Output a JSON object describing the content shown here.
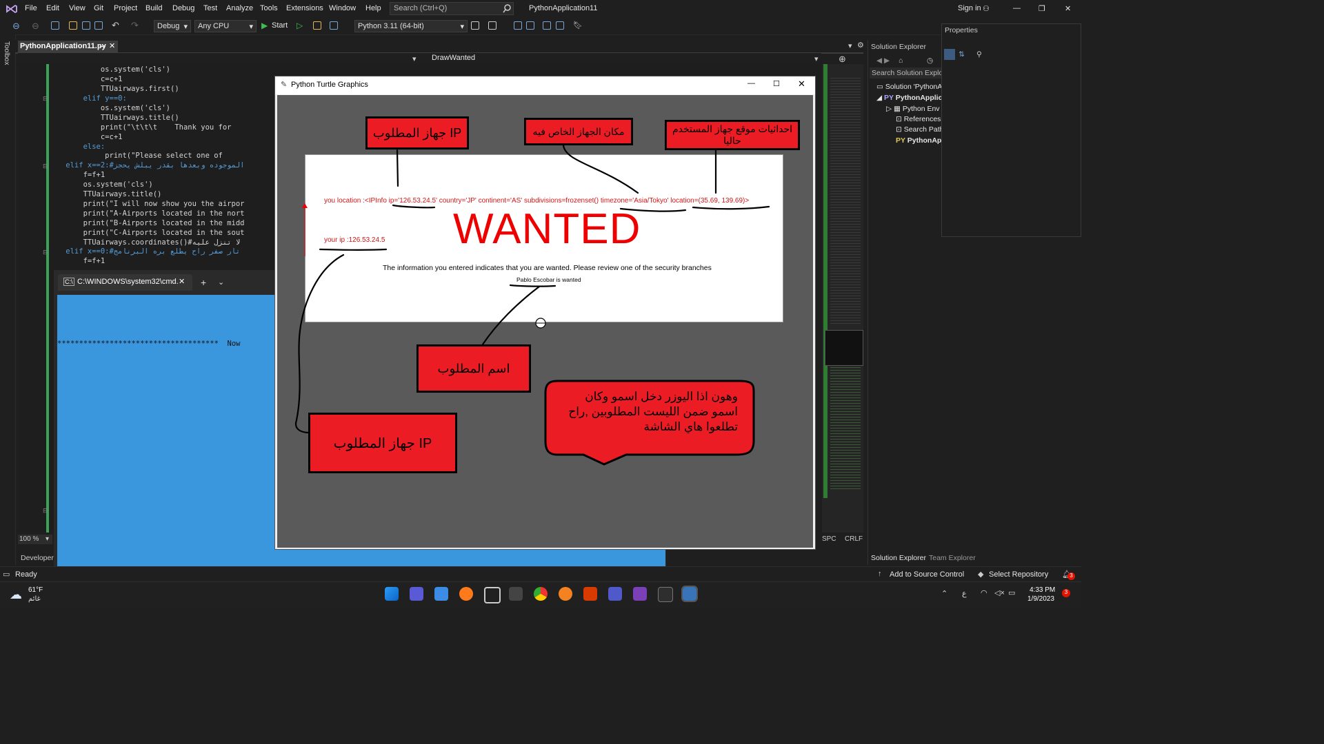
{
  "menu": {
    "items": [
      "File",
      "Edit",
      "View",
      "Git",
      "Project",
      "Build",
      "Debug",
      "Test",
      "Analyze",
      "Tools",
      "Extensions",
      "Window",
      "Help"
    ],
    "search_placeholder": "Search (Ctrl+Q)",
    "project_name": "PythonApplication11",
    "sign_in": "Sign in"
  },
  "toolbar": {
    "config": "Debug",
    "platform": "Any CPU",
    "start_label": "Start",
    "env": "Python 3.11 (64-bit)"
  },
  "editor": {
    "tab_title": "PythonApplication11.py",
    "nav_function": "DrawWanted",
    "zoom": "100 %",
    "toolbox_label": "Toolbox",
    "status_spc": "SPC",
    "status_crlf": "CRLF",
    "lines": [
      "            os.system('cls')",
      "            c=c+1",
      "            TTUairways.first()",
      "        elif y==0:",
      "            os.system('cls')",
      "            TTUairways.title()",
      "            print(\"\\t\\t\\t    Thank you for",
      "            c=c+1",
      "        else:",
      "             print(\"Please select one of",
      "    elif x==2:#الموجوده وبعدها بقدر يبلش يحجز",
      "        f=f+1",
      "        os.system('cls')",
      "        TTUairways.title()",
      "        print(\"I will now show you the airpor",
      "        print(\"A-Airports located in the nort",
      "        print(\"B-Airports located in the midd",
      "        print(\"C-Airports located in the sout",
      "        TTUairways.coordinates()#لا تنزل عليه",
      "    elif x==0:#تار صفر راح يطلع بره البرنامج",
      "        f=f+1"
    ]
  },
  "cmd": {
    "tab_title": "C:\\WINDOWS\\system32\\cmd.",
    "line": "*************************************  Now"
  },
  "turtle": {
    "window_title": "Python Turtle Graphics",
    "location_text": "you location :<IPInfo ip='126.53.24.5' country='JP' continent='AS' subdivisions=frozenset() timezone='Asia/Tokyo' location=(35.69, 139.69)>",
    "ip_text": "your ip :126.53.24.5",
    "wanted_title": "WANTED",
    "info_text": "The information you entered indicates that you are wanted. Please review one of the security branches",
    "name_text": "Pablo Escobar is wanted",
    "callouts": {
      "ip_top": "IP جهاز المطلوب",
      "device_place": "مكان الجهاز الخاص فيه",
      "coordinates": "احداثيات موقع جهاز المستخدم حاليا",
      "wanted_name": "اسم المطلوب",
      "ip_bottom": "IP جهاز المطلوب",
      "speech": "وهون اذا اليوزر دخل اسمو وكان اسمو ضمن الليست المطلوبين ,راح تطلعوا هاي الشاشة"
    }
  },
  "solution_explorer": {
    "title": "Solution Explorer",
    "search": "Search Solution Explore",
    "items": [
      "Solution 'PythonA",
      "PythonApplica",
      "Python Env",
      "References",
      "Search Path",
      "PythonApp"
    ],
    "bottom_tabs": [
      "Solution Explorer",
      "Team Explorer"
    ]
  },
  "properties": {
    "title": "Properties"
  },
  "statusbar": {
    "ready": "Ready",
    "developer": "Developer",
    "add_source": "Add to Source Control",
    "select_repo": "Select Repository",
    "notif_count": "3"
  },
  "taskbar": {
    "temp": "61°F",
    "weather": "غائم",
    "time": "4:33 PM",
    "date": "1/9/2023",
    "lang": "ع"
  }
}
